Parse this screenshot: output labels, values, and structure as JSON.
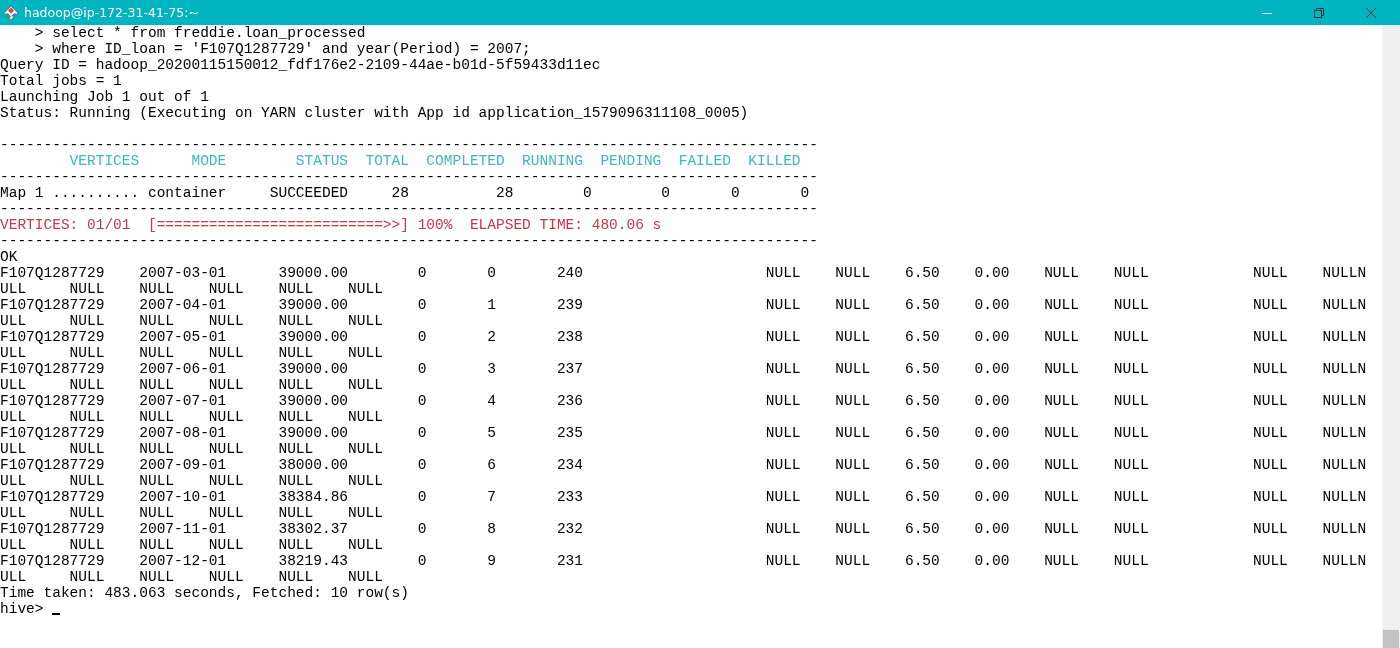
{
  "window": {
    "title": "hadoop@ip-172-31-41-75:~"
  },
  "lines": [
    {
      "kind": "plain",
      "text": "    > select * from freddie.loan_processed"
    },
    {
      "kind": "plain",
      "text": "    > where ID_loan = 'F107Q1287729' and year(Period) = 2007;"
    },
    {
      "kind": "plain",
      "text": "Query ID = hadoop_20200115150012_fdf176e2-2109-44ae-b01d-5f59433d11ec"
    },
    {
      "kind": "plain",
      "text": "Total jobs = 1"
    },
    {
      "kind": "plain",
      "text": "Launching Job 1 out of 1"
    },
    {
      "kind": "plain",
      "text": "Status: Running (Executing on YARN cluster with App id application_1579096311108_0005)"
    },
    {
      "kind": "blank"
    },
    {
      "kind": "rule",
      "text": "----------------------------------------------------------------------------------------------"
    },
    {
      "kind": "header",
      "text": "        VERTICES      MODE        STATUS  TOTAL  COMPLETED  RUNNING  PENDING  FAILED  KILLED"
    },
    {
      "kind": "rule",
      "text": "----------------------------------------------------------------------------------------------"
    },
    {
      "kind": "plain",
      "text": "Map 1 .......... container     SUCCEEDED     28          28        0        0       0       0"
    },
    {
      "kind": "rule",
      "text": "----------------------------------------------------------------------------------------------"
    },
    {
      "kind": "progress",
      "text": "VERTICES: 01/01  [==========================>>] 100%  ELAPSED TIME: 480.06 s"
    },
    {
      "kind": "rule",
      "text": "----------------------------------------------------------------------------------------------"
    },
    {
      "kind": "plain",
      "text": "OK"
    },
    {
      "kind": "plain",
      "text": "F107Q1287729    2007-03-01      39000.00        0       0       240                     NULL    NULL    6.50    0.00    NULL    NULL            NULL    NULLN"
    },
    {
      "kind": "plain",
      "text": "ULL     NULL    NULL    NULL    NULL    NULL"
    },
    {
      "kind": "plain",
      "text": "F107Q1287729    2007-04-01      39000.00        0       1       239                     NULL    NULL    6.50    0.00    NULL    NULL            NULL    NULLN"
    },
    {
      "kind": "plain",
      "text": "ULL     NULL    NULL    NULL    NULL    NULL"
    },
    {
      "kind": "plain",
      "text": "F107Q1287729    2007-05-01      39000.00        0       2       238                     NULL    NULL    6.50    0.00    NULL    NULL            NULL    NULLN"
    },
    {
      "kind": "plain",
      "text": "ULL     NULL    NULL    NULL    NULL    NULL"
    },
    {
      "kind": "plain",
      "text": "F107Q1287729    2007-06-01      39000.00        0       3       237                     NULL    NULL    6.50    0.00    NULL    NULL            NULL    NULLN"
    },
    {
      "kind": "plain",
      "text": "ULL     NULL    NULL    NULL    NULL    NULL"
    },
    {
      "kind": "plain",
      "text": "F107Q1287729    2007-07-01      39000.00        0       4       236                     NULL    NULL    6.50    0.00    NULL    NULL            NULL    NULLN"
    },
    {
      "kind": "plain",
      "text": "ULL     NULL    NULL    NULL    NULL    NULL"
    },
    {
      "kind": "plain",
      "text": "F107Q1287729    2007-08-01      39000.00        0       5       235                     NULL    NULL    6.50    0.00    NULL    NULL            NULL    NULLN"
    },
    {
      "kind": "plain",
      "text": "ULL     NULL    NULL    NULL    NULL    NULL"
    },
    {
      "kind": "plain",
      "text": "F107Q1287729    2007-09-01      38000.00        0       6       234                     NULL    NULL    6.50    0.00    NULL    NULL            NULL    NULLN"
    },
    {
      "kind": "plain",
      "text": "ULL     NULL    NULL    NULL    NULL    NULL"
    },
    {
      "kind": "plain",
      "text": "F107Q1287729    2007-10-01      38384.86        0       7       233                     NULL    NULL    6.50    0.00    NULL    NULL            NULL    NULLN"
    },
    {
      "kind": "plain",
      "text": "ULL     NULL    NULL    NULL    NULL    NULL"
    },
    {
      "kind": "plain",
      "text": "F107Q1287729    2007-11-01      38302.37        0       8       232                     NULL    NULL    6.50    0.00    NULL    NULL            NULL    NULLN"
    },
    {
      "kind": "plain",
      "text": "ULL     NULL    NULL    NULL    NULL    NULL"
    },
    {
      "kind": "plain",
      "text": "F107Q1287729    2007-12-01      38219.43        0       9       231                     NULL    NULL    6.50    0.00    NULL    NULL            NULL    NULLN"
    },
    {
      "kind": "plain",
      "text": "ULL     NULL    NULL    NULL    NULL    NULL"
    },
    {
      "kind": "plain",
      "text": "Time taken: 483.063 seconds, Fetched: 10 row(s)"
    },
    {
      "kind": "prompt",
      "text": "hive> "
    }
  ]
}
